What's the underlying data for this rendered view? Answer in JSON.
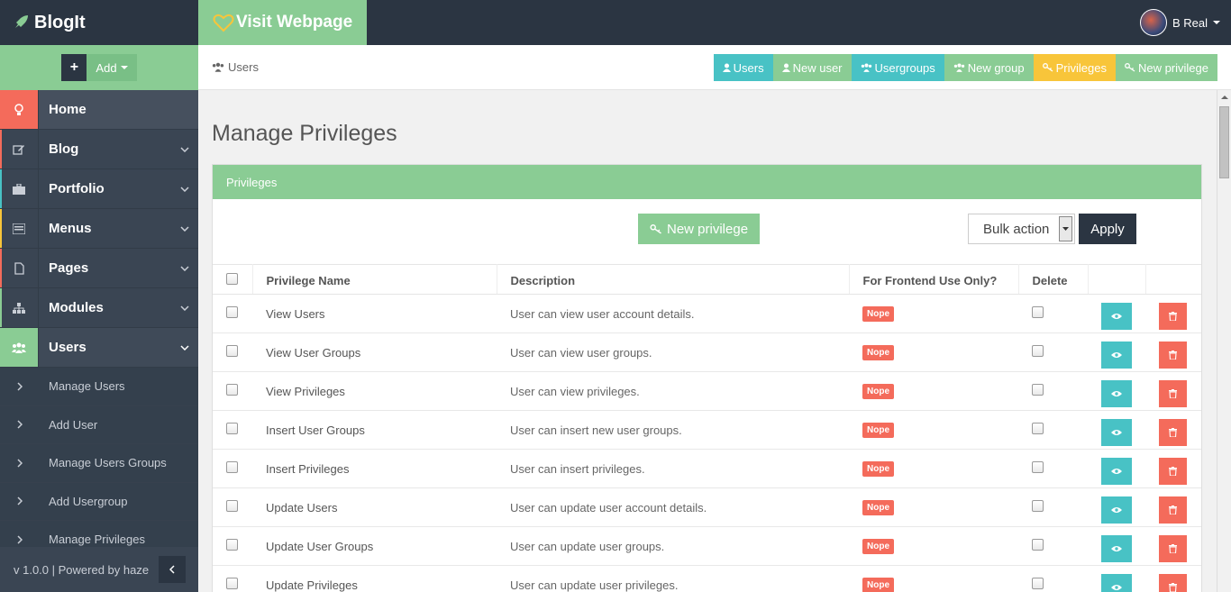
{
  "brand": {
    "name": "BlogIt"
  },
  "sidebar": {
    "add_label": "Add",
    "items": [
      {
        "label": "Home",
        "icon": "lightbulb-icon"
      },
      {
        "label": "Blog",
        "icon": "edit-icon"
      },
      {
        "label": "Portfolio",
        "icon": "briefcase-icon"
      },
      {
        "label": "Menus",
        "icon": "list-icon"
      },
      {
        "label": "Pages",
        "icon": "file-icon"
      },
      {
        "label": "Modules",
        "icon": "sitemap-icon"
      },
      {
        "label": "Users",
        "icon": "users-icon"
      }
    ],
    "sub_items": [
      {
        "label": "Manage Users"
      },
      {
        "label": "Add User"
      },
      {
        "label": "Manage Users Groups"
      },
      {
        "label": "Add Usergroup"
      },
      {
        "label": "Manage Privileges"
      }
    ],
    "footer": "v 1.0.0 | Powered by haze"
  },
  "topbar": {
    "visit_label": "Visit Webpage",
    "user_name": "B Real"
  },
  "breadcrumb": {
    "label": "Users"
  },
  "quick_links": [
    {
      "label": "Users",
      "color": "#48c2c5"
    },
    {
      "label": "New user",
      "color": "#8acc94"
    },
    {
      "label": "Usergroups",
      "color": "#48c2c5"
    },
    {
      "label": "New group",
      "color": "#8acc94"
    },
    {
      "label": "Privileges",
      "color": "#f8c53a"
    },
    {
      "label": "New privilege",
      "color": "#8acc94"
    }
  ],
  "page": {
    "title": "Manage Privileges",
    "panel_title": "Privileges",
    "new_button": "New privilege",
    "bulk_action": "Bulk action",
    "apply": "Apply"
  },
  "table": {
    "headers": [
      "Privilege Name",
      "Description",
      "For Frontend Use Only?",
      "Delete"
    ],
    "rows": [
      {
        "name": "View Users",
        "desc": "User can view user account details.",
        "frontend": "Nope"
      },
      {
        "name": "View User Groups",
        "desc": "User can view user groups.",
        "frontend": "Nope"
      },
      {
        "name": "View Privileges",
        "desc": "User can view privileges.",
        "frontend": "Nope"
      },
      {
        "name": "Insert User Groups",
        "desc": "User can insert new user groups.",
        "frontend": "Nope"
      },
      {
        "name": "Insert Privileges",
        "desc": "User can insert privileges.",
        "frontend": "Nope"
      },
      {
        "name": "Update Users",
        "desc": "User can update user account details.",
        "frontend": "Nope"
      },
      {
        "name": "Update User Groups",
        "desc": "User can update user groups.",
        "frontend": "Nope"
      },
      {
        "name": "Update Privileges",
        "desc": "User can update user privileges.",
        "frontend": "Nope"
      }
    ]
  },
  "colors": {
    "accent_green": "#8acc94",
    "teal": "#48c2c5",
    "red": "#f46b5b",
    "yellow": "#f8c53a",
    "dark": "#2b3542"
  }
}
